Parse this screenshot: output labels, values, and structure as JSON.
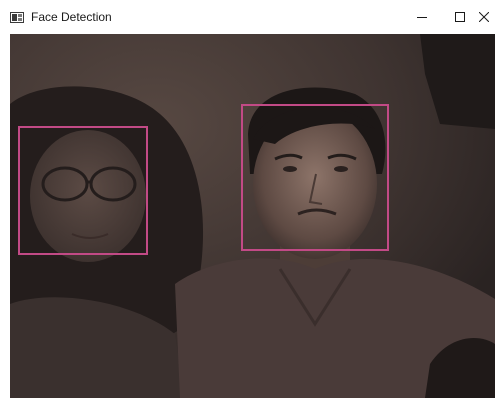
{
  "window": {
    "title": "Face Detection",
    "icon": "opencv-window-icon"
  },
  "caption_buttons": {
    "minimize_icon": "minimize-icon",
    "maximize_icon": "maximize-icon",
    "close_icon": "close-icon"
  },
  "camera": {
    "detections": [
      {
        "label": "face",
        "box_color": "#c24a86"
      },
      {
        "label": "face",
        "box_color": "#c24a86"
      }
    ],
    "detected_face_count": 2
  }
}
